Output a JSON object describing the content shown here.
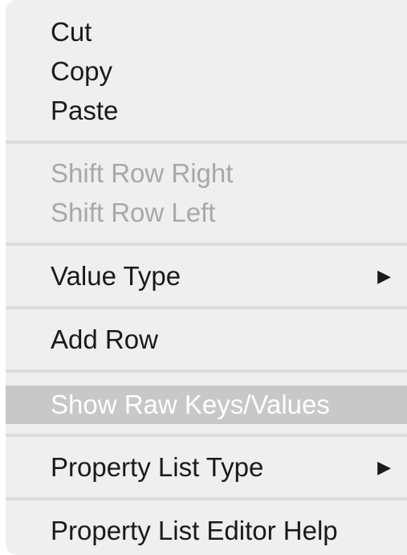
{
  "menu": {
    "items": [
      {
        "label": "Cut",
        "state": "enabled"
      },
      {
        "label": "Copy",
        "state": "enabled"
      },
      {
        "label": "Paste",
        "state": "enabled"
      },
      {
        "label": "Shift Row Right",
        "state": "disabled"
      },
      {
        "label": "Shift Row Left",
        "state": "disabled"
      },
      {
        "label": "Value Type",
        "state": "enabled",
        "submenu_icon": "triangle-right-icon",
        "submenu_glyph": "▶"
      },
      {
        "label": "Add Row",
        "state": "enabled"
      },
      {
        "label": "Show Raw Keys/Values",
        "state": "highlighted"
      },
      {
        "label": "Property List Type",
        "state": "enabled",
        "submenu_icon": "triangle-right-icon",
        "submenu_glyph": "▶"
      },
      {
        "label": "Property List Editor Help",
        "state": "enabled"
      }
    ],
    "colors": {
      "background": "#efefef",
      "text": "#1a1a1a",
      "disabled_text": "#a8a8a8",
      "highlight": "#c8c8c8",
      "separator": "#dcdcdc"
    }
  }
}
